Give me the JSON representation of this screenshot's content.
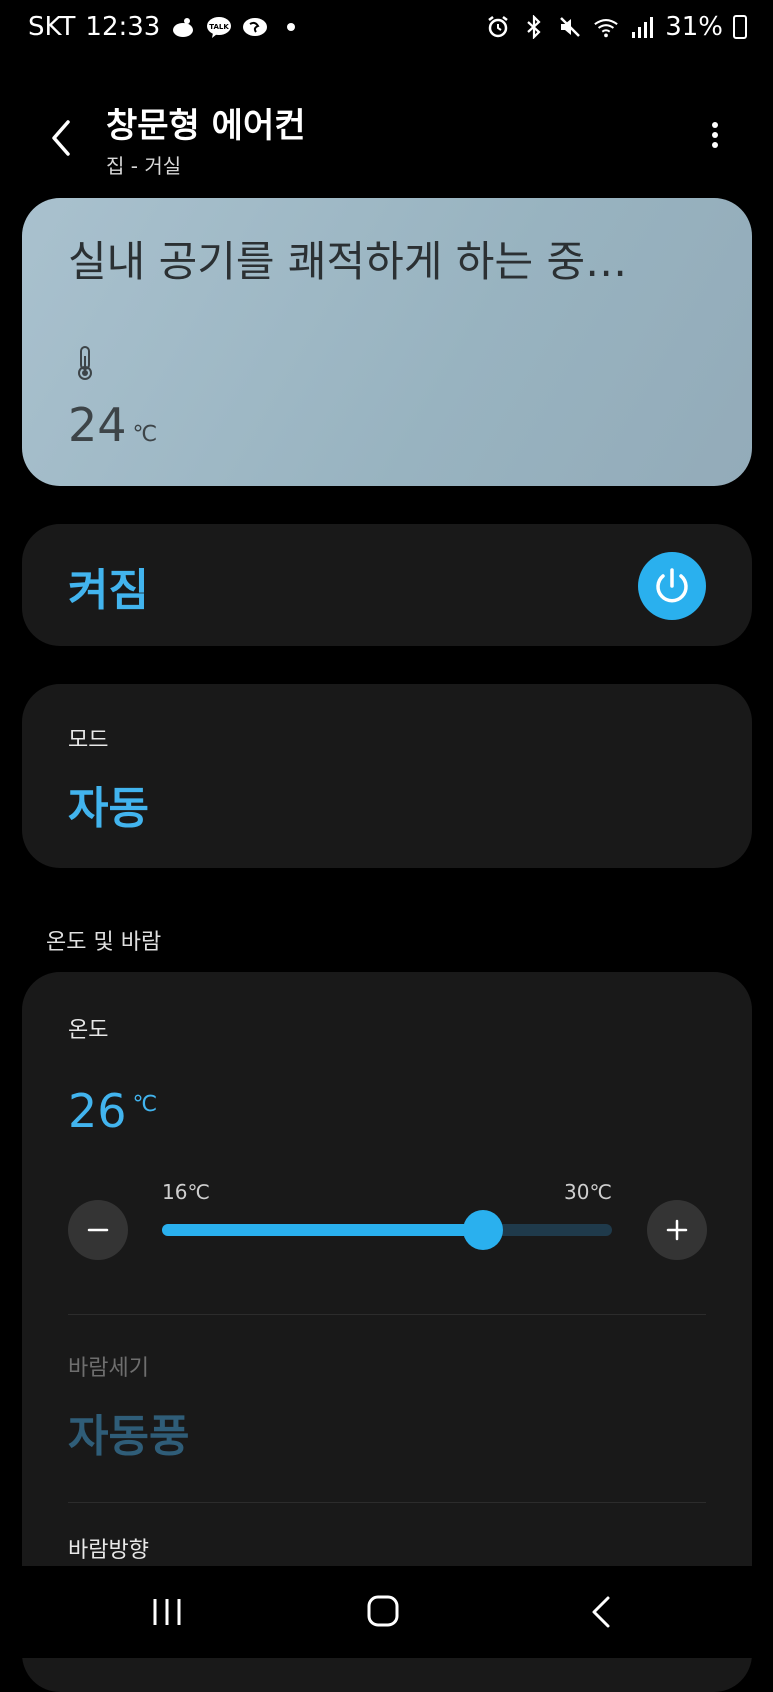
{
  "status_bar": {
    "carrier": "SKT",
    "time": "12:33",
    "battery_percent": "31%"
  },
  "header": {
    "title": "창문형 에어컨",
    "subtitle": "집 - 거실"
  },
  "hero": {
    "status_text": "실내 공기를 쾌적하게 하는 중…",
    "current_temp": "24",
    "unit": "℃"
  },
  "power": {
    "label": "켜짐"
  },
  "mode": {
    "label": "모드",
    "value": "자동"
  },
  "section": {
    "title": "온도 및 바람"
  },
  "temperature": {
    "label": "온도",
    "value": "26",
    "unit": "℃",
    "min_label": "16℃",
    "max_label": "30℃",
    "min": 16,
    "max": 30,
    "current": 26
  },
  "wind": {
    "label": "바람세기",
    "value": "자동풍"
  },
  "direction": {
    "label": "바람방향"
  },
  "colors": {
    "accent": "#2ab0ee",
    "hero_bg": "#a2bbc8",
    "card_bg": "#191919"
  }
}
